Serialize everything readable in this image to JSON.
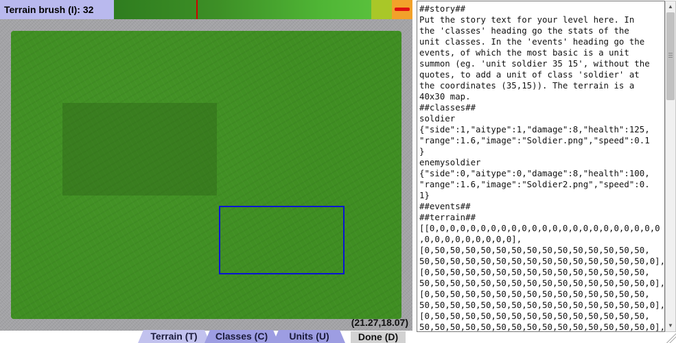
{
  "toolbar": {
    "brush_label": "Terrain brush (I): 32",
    "brush_marker_position": 0.32,
    "colors": {
      "brush_bar_bg": "#b9b9ee",
      "marker": "#d00000",
      "preview": "#a9c728",
      "minimize_bg": "#f2a12a"
    }
  },
  "map": {
    "coordinates": "(21.27,18.07)",
    "selection_color": "#0a14d4"
  },
  "tabs": [
    {
      "label": "Terrain (T)"
    },
    {
      "label": "Classes (C)"
    },
    {
      "label": "Units (U)"
    }
  ],
  "done_label": "Done (D)",
  "level_text": "##story##\nPut the story text for your level here. In\nthe 'classes' heading go the stats of the\nunit classes. In the 'events' heading go the\nevents, of which the most basic is a unit\nsummon (eg. 'unit soldier 35 15', without the\nquotes, to add a unit of class 'soldier' at\nthe coordinates (35,15)). The terrain is a\n40x30 map.\n##classes##\nsoldier\n{\"side\":1,\"aitype\":1,\"damage\":8,\"health\":125,\n\"range\":1.6,\"image\":\"Soldier.png\",\"speed\":0.1\n}\nenemysoldier\n{\"side\":0,\"aitype\":0,\"damage\":8,\"health\":100,\n\"range\":1.6,\"image\":\"Soldier2.png\",\"speed\":0.\n1}\n##events##\n##terrain##\n[[0,0,0,0,0,0,0,0,0,0,0,0,0,0,0,0,0,0,0,0,0,0,0\n,0,0,0,0,0,0,0,0,0],\n[0,50,50,50,50,50,50,50,50,50,50,50,50,50,50,\n50,50,50,50,50,50,50,50,50,50,50,50,50,50,50,0],\n[0,50,50,50,50,50,50,50,50,50,50,50,50,50,50,\n50,50,50,50,50,50,50,50,50,50,50,50,50,50,50,0],\n[0,50,50,50,50,50,50,50,50,50,50,50,50,50,50,\n50,50,50,50,50,50,50,50,50,50,50,50,50,50,50,0],\n[0,50,50,50,50,50,50,50,50,50,50,50,50,50,50,\n50,50,50,50,50,50,50,50,50,50,50,50,50,50,50,0],"
}
